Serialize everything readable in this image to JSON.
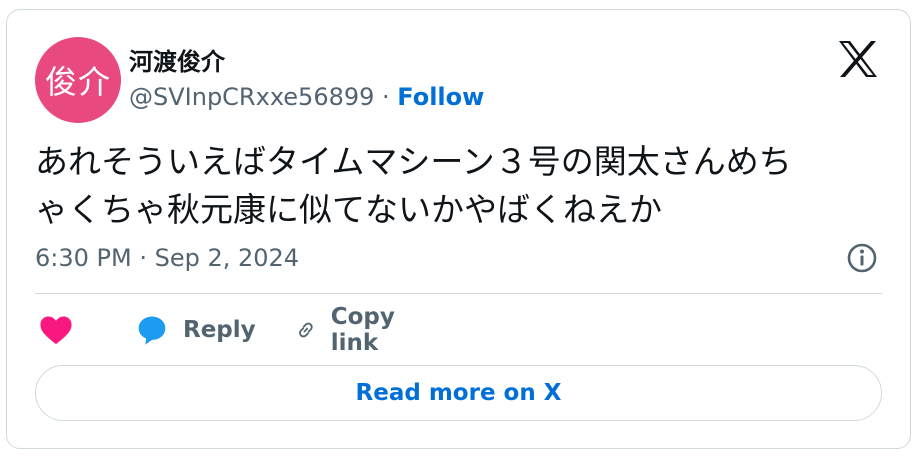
{
  "author": {
    "avatar_text": "俊介",
    "avatar_color": "#e8497f",
    "display_name": "河渡俊介",
    "handle": "@SVInpCRxxe56899",
    "separator": " · ",
    "follow_label": "Follow"
  },
  "tweet": {
    "line1": "あれそういえばタイムマシーン３号の関太さんめち",
    "line2": "ゃくちゃ秋元康に似てないかやばくねえか",
    "time": "6:30 PM",
    "date_separator": " · ",
    "date": "Sep 2, 2024"
  },
  "actions": {
    "like_icon": "heart-icon",
    "reply_label": "Reply",
    "reply_icon": "speech-bubble-icon",
    "copy_label": "Copy link",
    "copy_icon": "link-icon"
  },
  "cta": {
    "read_more_label": "Read more on X"
  },
  "colors": {
    "accent": "#006fd6",
    "like": "#f91880",
    "reply": "#1d9bf0",
    "muted": "#536471",
    "border": "#cfd9de"
  }
}
